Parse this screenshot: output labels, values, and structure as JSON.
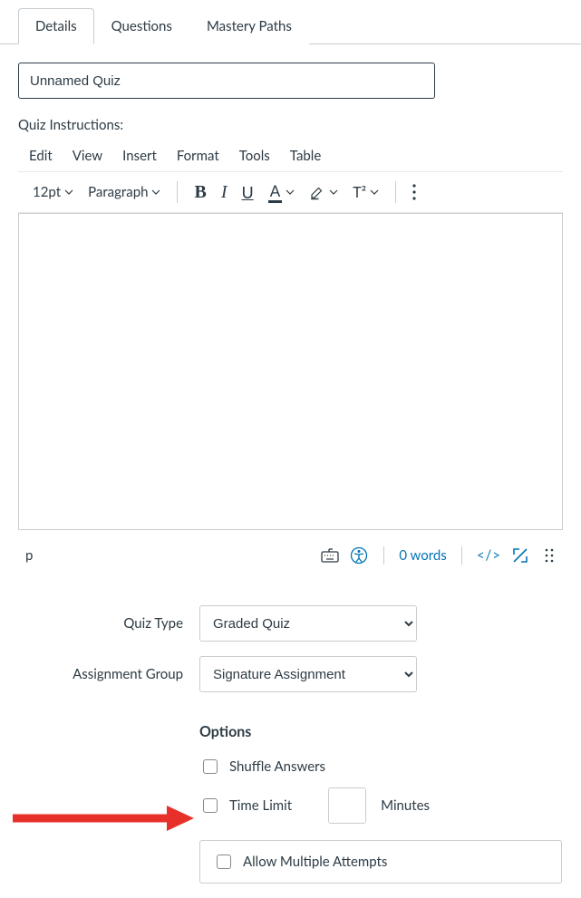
{
  "tabs": {
    "details": "Details",
    "questions": "Questions",
    "mastery": "Mastery Paths"
  },
  "title_value": "Unnamed Quiz",
  "instructions_label": "Quiz Instructions:",
  "editor_menu": {
    "edit": "Edit",
    "view": "View",
    "insert": "Insert",
    "format": "Format",
    "tools": "Tools",
    "table": "Table"
  },
  "toolbar": {
    "font_size": "12pt",
    "paragraph": "Paragraph",
    "bold": "B",
    "italic": "I",
    "underline": "U",
    "color": "A",
    "superscript": "T²"
  },
  "status": {
    "path": "p",
    "wordcount": "0 words",
    "code": "</>"
  },
  "fields": {
    "quiz_type_label": "Quiz Type",
    "quiz_type_value": "Graded Quiz",
    "assignment_group_label": "Assignment Group",
    "assignment_group_value": "Signature Assignment"
  },
  "options": {
    "heading": "Options",
    "shuffle": "Shuffle Answers",
    "time_limit": "Time Limit",
    "minutes_label": "Minutes",
    "allow_multiple": "Allow Multiple Attempts"
  }
}
